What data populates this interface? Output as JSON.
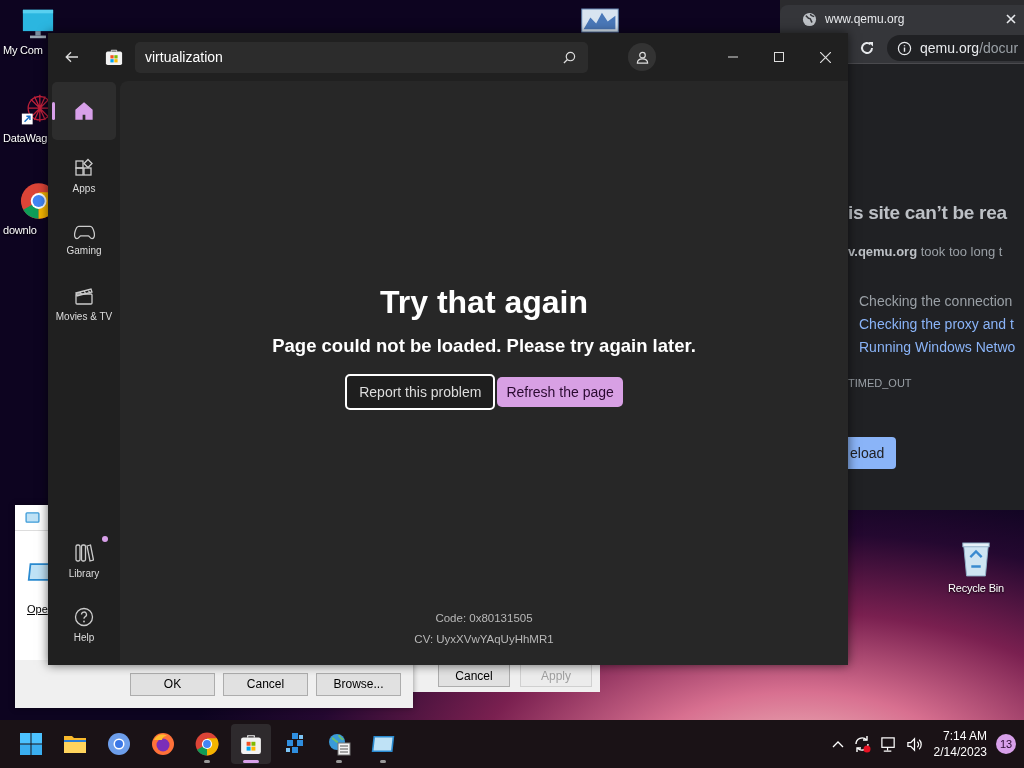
{
  "desktop_icons": [
    {
      "kind": "computer",
      "label": "My Com"
    },
    {
      "kind": "shortcut-app",
      "label": "DataWag"
    },
    {
      "kind": "chrome",
      "label": "downlo"
    },
    {
      "kind": "chart-app"
    },
    {
      "kind": "recycle-bin",
      "label": "Recycle Bin"
    }
  ],
  "browser": {
    "tab_title": "www.qemu.org",
    "address_host": "qemu.org",
    "address_path": "/docur",
    "heading": "is site can’t be rea",
    "message": "**v.qemu.org** took too long t",
    "suggestions": [
      {
        "text": "Checking the connection",
        "link": false
      },
      {
        "text": "Checking the proxy and t",
        "link": true
      },
      {
        "text": "Running Windows Netwo",
        "link": true
      }
    ],
    "error_code": "TIMED_OUT",
    "button": "eload"
  },
  "dialog": {
    "link_text": "Ope",
    "buttons": [
      {
        "label": "OK",
        "disabled": false
      },
      {
        "label": "Cancel",
        "disabled": false
      },
      {
        "label": "Browse...",
        "disabled": false
      }
    ]
  },
  "dialog_behind": {
    "buttons": [
      {
        "label": "Cancel",
        "disabled": false
      },
      {
        "label": "Apply",
        "disabled": true
      }
    ]
  },
  "store": {
    "search": {
      "value": "virtualization"
    },
    "nav": [
      {
        "kind": "home",
        "selected": true
      },
      {
        "kind": "apps",
        "label": "Apps",
        "selected": false
      },
      {
        "kind": "gaming",
        "label": "Gaming",
        "selected": false
      },
      {
        "kind": "movies",
        "label": "Movies & TV",
        "selected": false
      }
    ],
    "nav_bottom": [
      {
        "kind": "library",
        "label": "Library",
        "selected": false,
        "badge_dot": true
      },
      {
        "kind": "help",
        "label": "Help",
        "selected": false,
        "badge_dot": false
      }
    ],
    "error": {
      "title": "Try that again",
      "message": "Page could not be loaded. Please try again later.",
      "buttons": [
        {
          "kind": "secondary",
          "label": "Report this problem"
        },
        {
          "kind": "primary",
          "label": "Refresh the page"
        }
      ],
      "code": "Code: 0x80131505",
      "cv": "CV: UyxXVwYAqUyHhMR1"
    }
  },
  "taskbar": {
    "apps": [
      {
        "kind": "start",
        "running": false,
        "active": false
      },
      {
        "kind": "explorer",
        "running": false,
        "active": false
      },
      {
        "kind": "chromium",
        "running": false,
        "active": false
      },
      {
        "kind": "firefox",
        "running": false,
        "active": false
      },
      {
        "kind": "chrome",
        "running": true,
        "active": false
      },
      {
        "kind": "store",
        "running": true,
        "active": true
      },
      {
        "kind": "cubes",
        "running": false,
        "active": false
      },
      {
        "kind": "globe-list",
        "running": true,
        "active": false
      },
      {
        "kind": "vbox",
        "running": true,
        "active": false
      }
    ],
    "clock": {
      "time": "7:14 AM",
      "date": "2/14/2023"
    },
    "notifications": "13"
  }
}
